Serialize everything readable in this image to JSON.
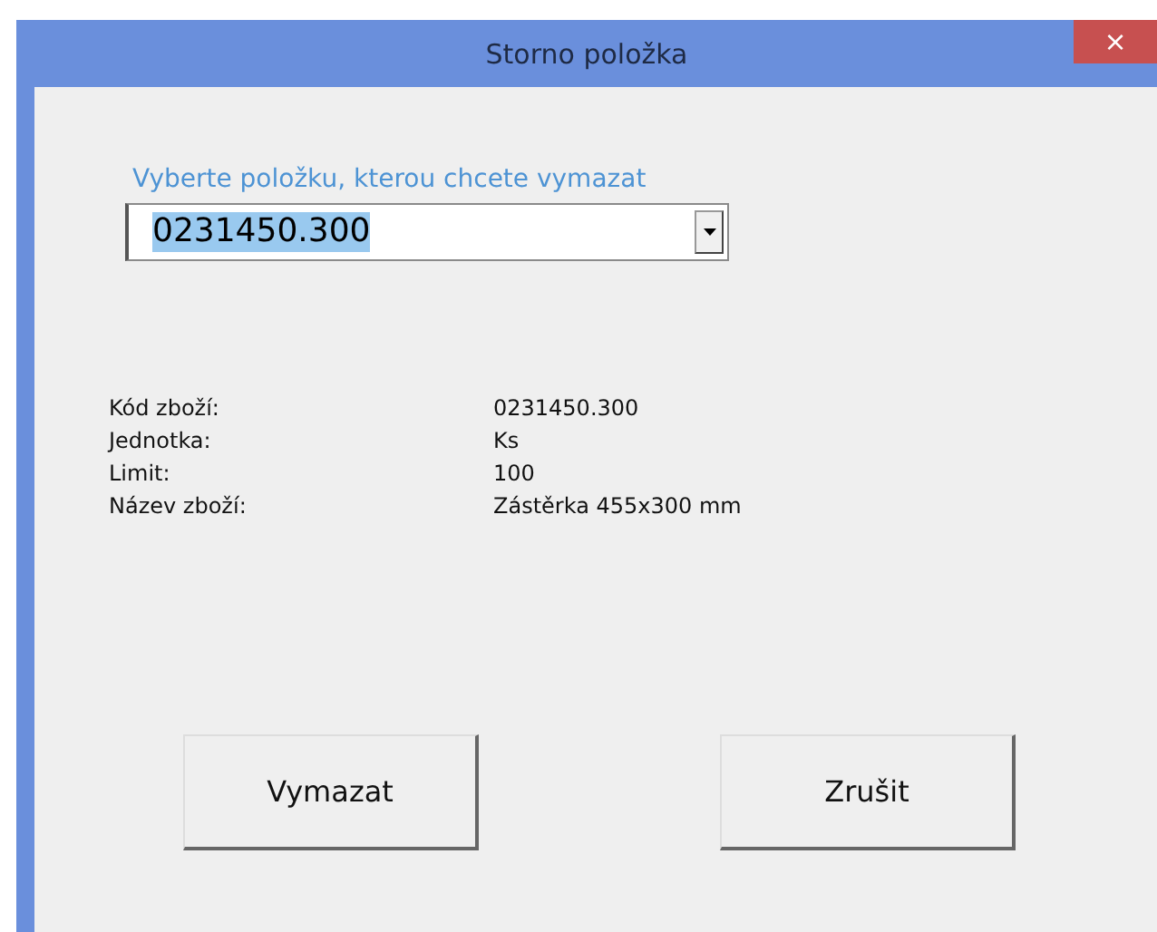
{
  "window": {
    "title": "Storno položka",
    "close": "×"
  },
  "prompt": "Vyberte položku, kterou chcete vymazat",
  "combo": {
    "value": "0231450.300",
    "selected": true
  },
  "details": [
    {
      "label": "Kód zboží:",
      "value": "0231450.300"
    },
    {
      "label": "Jednotka:",
      "value": "Ks"
    },
    {
      "label": "Limit:",
      "value": "100"
    },
    {
      "label": "Název zboží:",
      "value": "Zástěrka 455x300 mm"
    }
  ],
  "buttons": [
    "Vymazat",
    "Zrušit"
  ]
}
